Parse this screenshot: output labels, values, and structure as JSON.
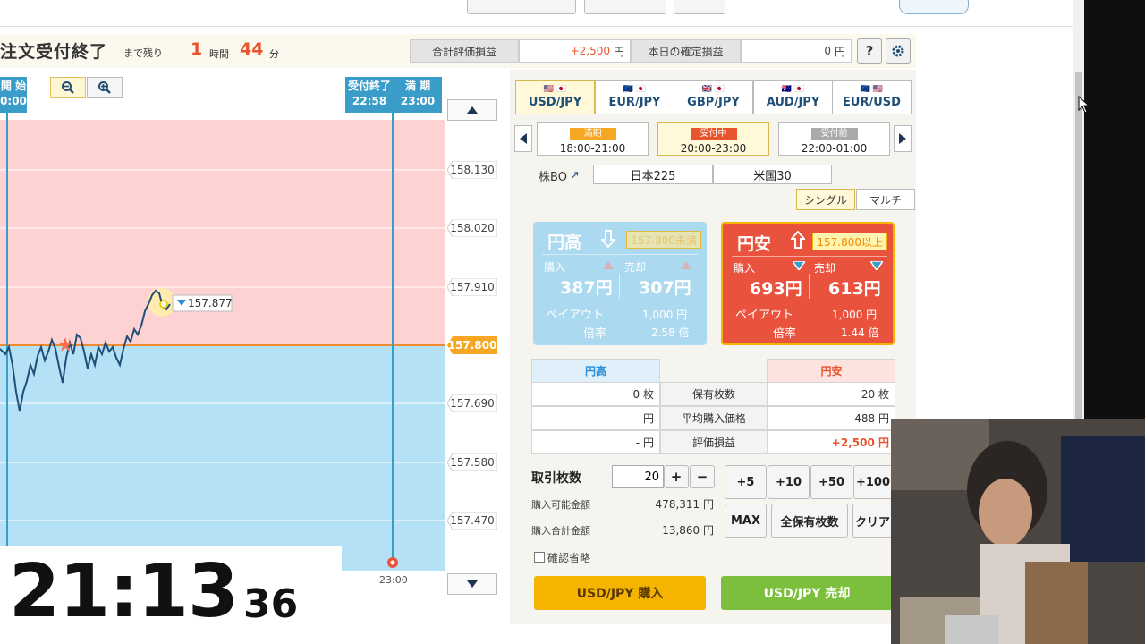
{
  "status": {
    "title": "注文受付終了",
    "remaining_label": "まで残り",
    "hours_value": "1",
    "hours_unit": "時間",
    "minutes_value": "44",
    "minutes_unit": "分"
  },
  "summary": {
    "total_eval_label": "合計評価損益",
    "total_eval_value": "+2,500",
    "total_eval_unit": "円",
    "today_label": "本日の確定損益",
    "today_value": "0",
    "today_unit": "円",
    "help_label": "?"
  },
  "chart": {
    "start_label": "開 始",
    "start_time": "0:00",
    "close_label": "受付終了",
    "close_time": "22:58",
    "expiry_label": "満 期",
    "expiry_time": "23:00",
    "x_tick": "23:00",
    "strike": "157.800",
    "current_price": "157.877",
    "price_ticks": [
      "158.130",
      "158.020",
      "157.910",
      "157.800",
      "157.690",
      "157.580",
      "157.470"
    ]
  },
  "clock": {
    "main": "21:13",
    "seconds": "36"
  },
  "currencies": [
    {
      "label": "USD/JPY",
      "flags": "🇺🇸 🇯🇵"
    },
    {
      "label": "EUR/JPY",
      "flags": "🇪🇺 🇯🇵"
    },
    {
      "label": "GBP/JPY",
      "flags": "🇬🇧 🇯🇵"
    },
    {
      "label": "AUD/JPY",
      "flags": "🇦🇺 🇯🇵"
    },
    {
      "label": "EUR/USD",
      "flags": "🇪🇺 🇺🇸"
    }
  ],
  "slots": [
    {
      "badge": "満期",
      "range": "18:00-21:00",
      "color": "#f5a623"
    },
    {
      "badge": "受付中",
      "range": "20:00-23:00",
      "color": "#e8542e"
    },
    {
      "badge": "受付前",
      "range": "22:00-01:00",
      "color": "#aaaaaa"
    }
  ],
  "products": {
    "stock_bo": "株BO",
    "nikkei": "日本225",
    "us30": "米国30"
  },
  "modes": {
    "single": "シングル",
    "multi": "マルチ"
  },
  "high_card": {
    "title": "円高",
    "condition": "157.800未満",
    "buy_label": "購入",
    "buy_price": "387円",
    "sell_label": "売却",
    "sell_price": "307円",
    "payout_label": "ペイアウト",
    "payout_value": "1,000 円",
    "ratio_label": "倍率",
    "ratio_value": "2.58 倍"
  },
  "low_card": {
    "title": "円安",
    "condition": "157.800以上",
    "buy_label": "購入",
    "buy_price": "693円",
    "sell_label": "売却",
    "sell_price": "613円",
    "payout_label": "ペイアウト",
    "payout_value": "1,000 円",
    "ratio_label": "倍率",
    "ratio_value": "1.44 倍"
  },
  "holdings": {
    "high_header": "円高",
    "low_header": "円安",
    "rows": [
      {
        "high": "0 枚",
        "label": "保有枚数",
        "low": "20 枚"
      },
      {
        "high": "- 円",
        "label": "平均購入価格",
        "low": "488 円"
      },
      {
        "high": "- 円",
        "label": "評価損益",
        "low": "+2,500 円"
      }
    ]
  },
  "order": {
    "qty_label": "取引枚数",
    "qty_value": "20",
    "plus": "+",
    "minus": "−",
    "available_label": "購入可能金額",
    "available_value": "478,311 円",
    "total_label": "購入合計金額",
    "total_value": "13,860 円",
    "inc_buttons": [
      "+5",
      "+10",
      "+50",
      "+100"
    ],
    "max": "MAX",
    "all_holdings": "全保有枚数",
    "clear": "クリア",
    "confirm_skip": "確認省略",
    "buy_button": "USD/JPY 購入",
    "sell_button": "USD/JPY 売却"
  },
  "colors": {
    "accent_orange": "#e8542e",
    "high_blue": "#a8d8f0",
    "low_red": "#e9533d",
    "buy_yellow": "#f5b400",
    "sell_green": "#7cbf3c",
    "chart_red_zone": "#fdd2d2",
    "chart_blue_zone": "#b5e1f7",
    "chart_line": "#1f4e79"
  }
}
